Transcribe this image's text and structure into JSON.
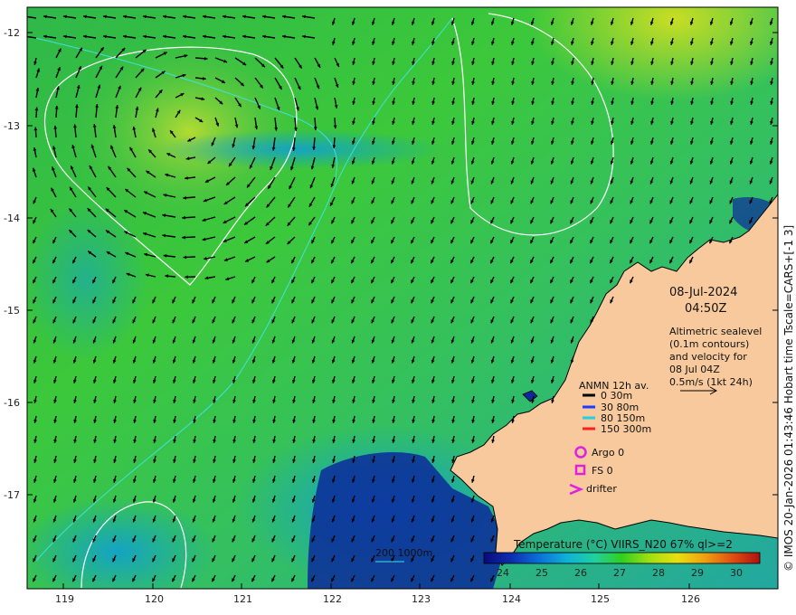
{
  "map": {
    "date": "08-Jul-2024",
    "time": "04:50Z",
    "info_lines": [
      "Altimetric sealevel",
      "(0.1m contours)",
      "and velocity for",
      "08 Jul 04Z",
      "0.5m/s (1kt 24h)"
    ],
    "credit": "© IMOS 20-Jan-2026 01:43:46 Hobart time Tscale=CARS+[-1 3]",
    "bathy_label": "200  1000m",
    "lat_ticks": [
      "-12",
      "-13",
      "-14",
      "-15",
      "-16",
      "-17"
    ],
    "lon_ticks": [
      "119",
      "120",
      "121",
      "122",
      "123",
      "124",
      "125",
      "126"
    ],
    "legend": {
      "title": "ANMN 12h av.",
      "items": [
        {
          "label": "0 30m",
          "color": "#000000"
        },
        {
          "label": "30 80m",
          "color": "#1a3cff"
        },
        {
          "label": "80 150m",
          "color": "#22d0e0"
        },
        {
          "label": "150 300m",
          "color": "#ff2020"
        }
      ],
      "markers": [
        {
          "label": "Argo 0",
          "color": "#e020e0"
        },
        {
          "label": "FS 0",
          "color": "#e020e0"
        },
        {
          "label": "drifter",
          "color": "#e020e0"
        }
      ]
    },
    "colorbar": {
      "title": "Temperature (°C) VIIRS_N20 67% ql>=2",
      "ticks": [
        "24",
        "25",
        "26",
        "27",
        "28",
        "29",
        "30"
      ],
      "colors": [
        "#0a0a7a",
        "#0c2fb0",
        "#0a70d8",
        "#10b0d8",
        "#20d0a0",
        "#30d020",
        "#a0e010",
        "#e8e010",
        "#f0a010",
        "#e05010",
        "#b01010"
      ]
    },
    "colors": {
      "land": "#f7c99c",
      "sea_main": "#38c040",
      "sea_dark": "#1030a0",
      "contour": "#ffffff",
      "bathy": "#40e0e0"
    }
  }
}
